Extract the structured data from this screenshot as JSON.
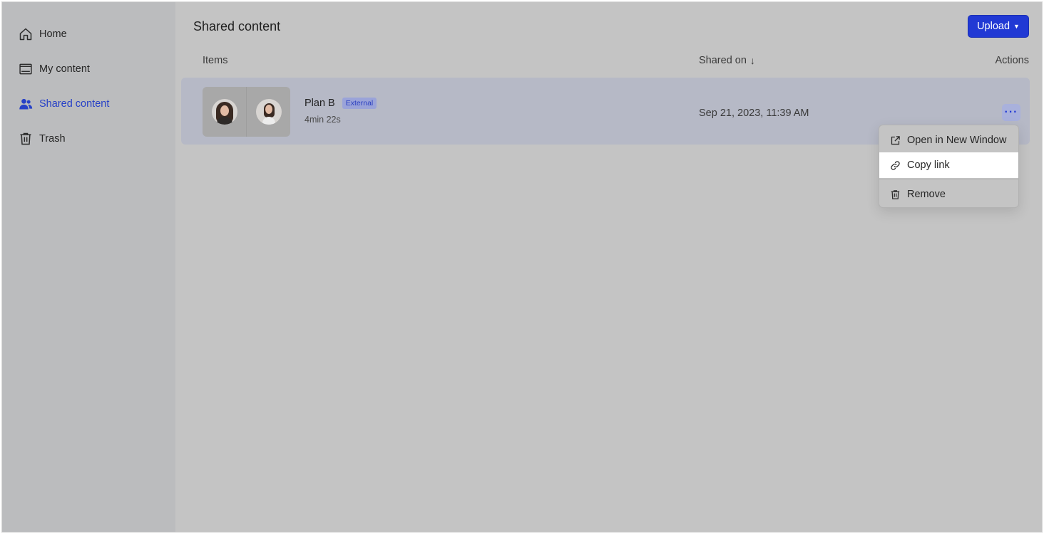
{
  "sidebar": {
    "items": [
      {
        "label": "Home",
        "icon": "home-icon",
        "active": false
      },
      {
        "label": "My content",
        "icon": "folder-icon",
        "active": false
      },
      {
        "label": "Shared content",
        "icon": "users-icon",
        "active": true
      },
      {
        "label": "Trash",
        "icon": "trash-icon",
        "active": false
      }
    ]
  },
  "header": {
    "title": "Shared content",
    "upload_label": "Upload"
  },
  "table": {
    "columns": {
      "items": "Items",
      "shared_on": "Shared on",
      "actions": "Actions"
    },
    "sort_icon": "arrow-down-icon",
    "rows": [
      {
        "name": "Plan B",
        "badge": "External",
        "duration": "4min 22s",
        "shared_on": "Sep 21, 2023, 11:39 AM"
      }
    ]
  },
  "context_menu": {
    "items": [
      {
        "label": "Open in New Window",
        "icon": "external-link-icon"
      },
      {
        "label": "Copy link",
        "icon": "link-icon",
        "highlighted": true
      },
      {
        "label": "Remove",
        "icon": "trash-icon"
      }
    ]
  },
  "colors": {
    "accent": "#2139d4",
    "active_nav": "#2741c7"
  }
}
